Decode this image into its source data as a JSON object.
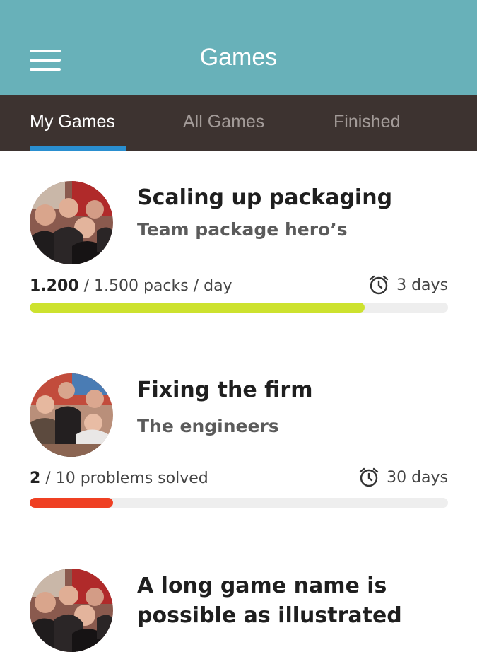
{
  "header": {
    "title": "Games",
    "color": "#68b1b9"
  },
  "tabs": [
    {
      "label": "My Games",
      "active": true
    },
    {
      "label": "All Games",
      "active": false
    },
    {
      "label": "Finished",
      "active": false
    }
  ],
  "games": [
    {
      "title": "Scaling up packaging",
      "team": "Team package hero’s",
      "progress_value": "1.200",
      "progress_rest": " / 1.500 packs / day",
      "progress_fraction": 0.8,
      "progress_color": "#cde22f",
      "deadline": "3 days",
      "icon": "alarm-clock-icon"
    },
    {
      "title": "Fixing the firm",
      "team": "The engineers",
      "progress_value": "2",
      "progress_rest": " / 10 problems solved",
      "progress_fraction": 0.2,
      "progress_color": "#ef4023",
      "deadline": "30 days",
      "icon": "alarm-clock-icon"
    },
    {
      "title": "A long game name is possible as illustrated",
      "team": ""
    }
  ]
}
